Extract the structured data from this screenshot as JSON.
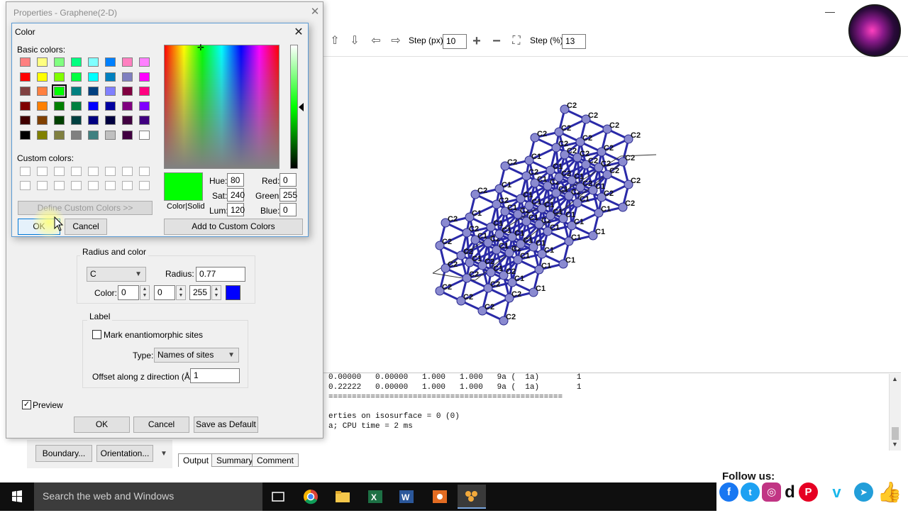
{
  "app": {
    "toolbar": {
      "step_px_label": "Step (px):",
      "step_px_value": "10",
      "step_pct_label": "Step (%):",
      "step_pct_value": "13"
    },
    "console_lines": [
      "0.00000   0.00000   1.000   1.000   9a (  1a)        1",
      "0.22222   0.00000   1.000   1.000   9a (  1a)        1",
      "==================================================",
      "",
      "erties on isosurface = 0 (0)",
      "a; CPU time = 2 ms"
    ],
    "output_tabs": [
      "Output",
      "Summary",
      "Comment"
    ],
    "left_buttons": {
      "boundary": "Boundary...",
      "orientation": "Orientation..."
    },
    "atom_label_outer": "C2",
    "atom_label_inner": "C1"
  },
  "properties": {
    "title": "Properties - Graphene(2-D)",
    "radius_color": {
      "legend": "Radius and color",
      "element": "C",
      "radius_label": "Radius:",
      "radius_value": "0.77",
      "color_label": "Color:",
      "r": "0",
      "g": "0",
      "b": "255",
      "swatch_color": "#0000ff"
    },
    "label": {
      "legend": "Label",
      "mark_enantiomorphic": "Mark enantiomorphic sites",
      "type_label": "Type:",
      "type_value": "Names of sites",
      "offset_label": "Offset along z direction (Å):",
      "offset_value": "1"
    },
    "preview_label": "Preview",
    "buttons": {
      "ok": "OK",
      "cancel": "Cancel",
      "save_default": "Save as Default"
    }
  },
  "color_dialog": {
    "title": "Color",
    "basic_colors_label": "Basic colors:",
    "custom_colors_label": "Custom colors:",
    "define_custom_button": "Define Custom Colors >>",
    "ok": "OK",
    "cancel": "Cancel",
    "color_solid_label": "Color|Solid",
    "hue_label": "Hue:",
    "hue": "80",
    "sat_label": "Sat:",
    "sat": "240",
    "lum_label": "Lum:",
    "lum": "120",
    "red_label": "Red:",
    "red": "0",
    "green_label": "Green:",
    "green": "255",
    "blue_label": "Blue:",
    "blue": "0",
    "add_custom_button": "Add to Custom Colors",
    "selected_color": "#00ff00",
    "basic_colors": [
      "#ff8080",
      "#ffff80",
      "#80ff80",
      "#00ff80",
      "#80ffff",
      "#0080ff",
      "#ff80c0",
      "#ff80ff",
      "#ff0000",
      "#ffff00",
      "#80ff00",
      "#00ff40",
      "#00ffff",
      "#0080c0",
      "#8080c0",
      "#ff00ff",
      "#804040",
      "#ff8040",
      "#00ff00",
      "#008080",
      "#004080",
      "#8080ff",
      "#800040",
      "#ff0080",
      "#800000",
      "#ff8000",
      "#008000",
      "#008040",
      "#0000ff",
      "#0000a0",
      "#800080",
      "#8000ff",
      "#400000",
      "#804000",
      "#004000",
      "#004040",
      "#000080",
      "#000040",
      "#400040",
      "#400080",
      "#000000",
      "#808000",
      "#808040",
      "#808080",
      "#408080",
      "#c0c0c0",
      "#400040",
      "#ffffff"
    ]
  },
  "taskbar": {
    "search_placeholder": "Search the web and Windows"
  },
  "follow": {
    "title": "Follow us:",
    "icons": [
      "facebook-icon",
      "twitter-icon",
      "instagram-icon",
      "dailymotion-icon",
      "pinterest-icon",
      "vimeo-icon",
      "telegram-icon",
      "thumbs-up-icon"
    ]
  }
}
